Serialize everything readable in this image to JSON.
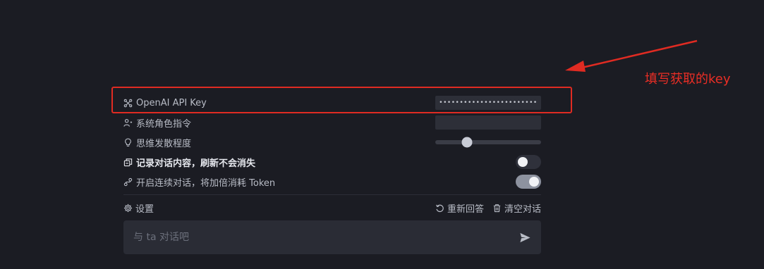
{
  "settings": {
    "api_key_label": "OpenAI API Key",
    "api_key_value": "••••••••••••••••••••••••",
    "system_role_label": "系统角色指令",
    "system_role_value": "",
    "creativity_label": "思维发散程度",
    "creativity_level": 0.3,
    "save_history_label": "记录对话内容，刷新不会消失",
    "save_history_on": false,
    "continuous_label": "开启连续对话，将加倍消耗 Token",
    "continuous_on": true
  },
  "footer": {
    "settings_label": "设置",
    "regenerate_label": "重新回答",
    "clear_label": "清空对话"
  },
  "composer": {
    "placeholder": "与 ta 对话吧"
  },
  "annotation": {
    "text": "填写获取的key",
    "color": "#e02b22"
  },
  "icons": {
    "api_key": "key-nodes-icon",
    "system_role": "user-role-icon",
    "creativity": "lightbulb-icon",
    "save_history": "save-history-icon",
    "continuous": "link-chat-icon",
    "settings": "gear-icon",
    "regenerate": "refresh-icon",
    "clear": "trash-icon",
    "send": "send-icon"
  }
}
